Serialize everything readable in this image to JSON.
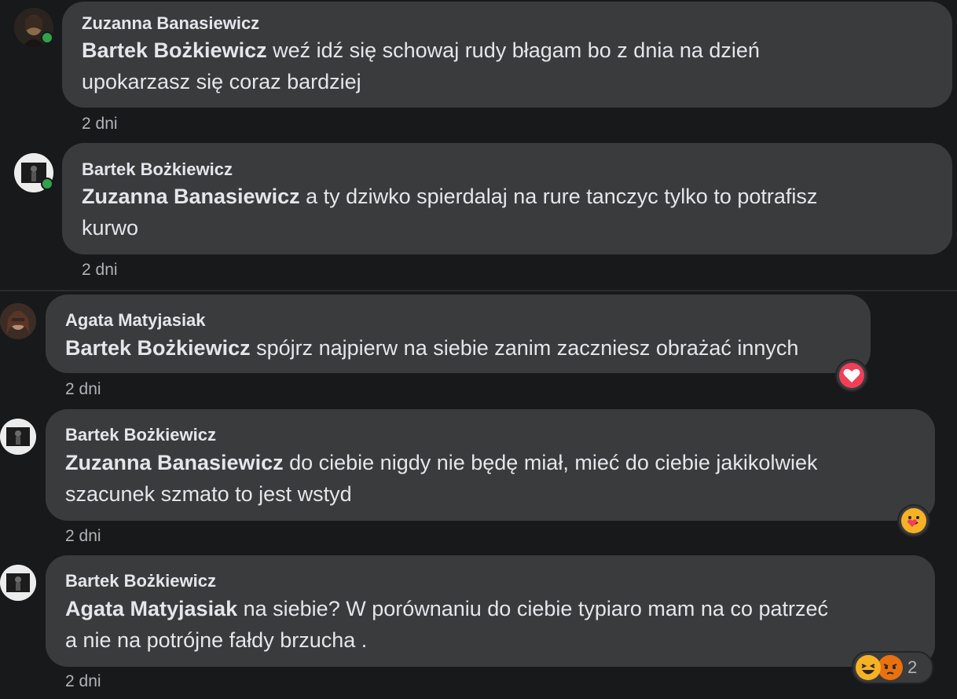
{
  "comments": [
    {
      "author": "Zuzanna Banasiewicz",
      "mention": "Bartek Bożkiewicz",
      "line1": " weź idź się schowaj rudy błagam bo z dnia na dzień",
      "line2": "upokarzasz się coraz bardziej",
      "time": "2 dni"
    },
    {
      "author": "Bartek Bożkiewicz",
      "mention": "Zuzanna Banasiewicz",
      "line1": " a ty dziwko spierdalaj na rure tanczyc tylko to potrafisz",
      "line2": "kurwo",
      "time": "2 dni"
    },
    {
      "author": "Agata Matyjasiak",
      "mention": "Bartek Bożkiewicz",
      "line1": " spójrz najpierw na siebie zanim zaczniesz obrażać innych",
      "time": "2 dni",
      "reaction": {
        "icon": "love-reaction-icon",
        "color": "#f33e58"
      }
    },
    {
      "author": "Bartek Bożkiewicz",
      "mention": "Zuzanna Banasiewicz",
      "line1": " do ciebie nigdy nie będę miał, mieć do ciebie jakikolwiek",
      "line2": "szacunek szmato to jest wstyd",
      "time": "2 dni",
      "reaction": {
        "icon": "care-reaction-icon",
        "color": "#f7b125"
      }
    },
    {
      "author": "Bartek Bożkiewicz",
      "mention": "Agata Matyjasiak",
      "line1": " na siebie? W porównaniu do ciebie typiaro mam na co patrzeć",
      "line2": "a nie na potrójne fałdy brzucha .",
      "time": "2 dni",
      "reaction": {
        "icons": [
          "haha-reaction-icon",
          "angry-reaction-icon"
        ],
        "count": "2"
      }
    }
  ],
  "colors": {
    "background": "#18191a",
    "bubble": "#3a3b3c",
    "text": "#e4e6eb",
    "secondary": "#b0b3b8",
    "online": "#31a24c"
  }
}
